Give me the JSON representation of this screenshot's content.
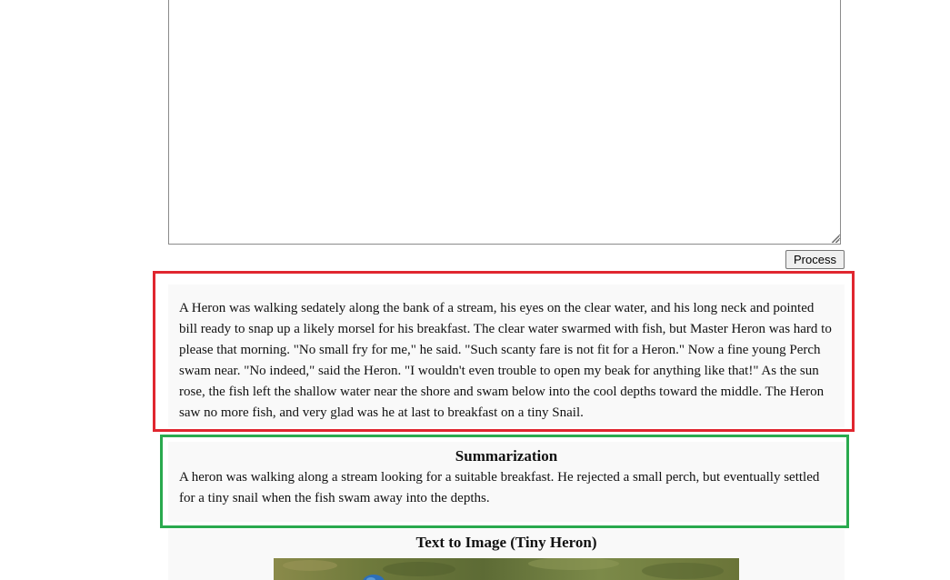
{
  "input": {
    "value": "",
    "placeholder": ""
  },
  "process_button": {
    "label": "Process"
  },
  "source": {
    "text": "A Heron was walking sedately along the bank of a stream, his eyes on the clear water, and his long neck and pointed bill ready to snap up a likely morsel for his breakfast. The clear water swarmed with fish, but Master Heron was hard to please that morning. \"No small fry for me,\" he said. \"Such scanty fare is not fit for a Heron.\" Now a fine young Perch swam near. \"No indeed,\" said the Heron. \"I wouldn't even trouble to open my beak for anything like that!\" As the sun rose, the fish left the shallow water near the shore and swam below into the cool depths toward the middle. The Heron saw no more fish, and very glad was he at last to breakfast on a tiny Snail."
  },
  "summary": {
    "title": "Summarization",
    "text": "A heron was walking along a stream looking for a suitable breakfast. He rejected a small perch, but eventually settled for a tiny snail when the fish swam away into the depths."
  },
  "text_to_image": {
    "title": "Text to Image (Tiny Heron)",
    "image_icon": "heron-photo"
  },
  "colors": {
    "source_highlight": "#e0262f",
    "summary_highlight": "#2aaa4e",
    "panel_background": "#f9f9f9"
  }
}
